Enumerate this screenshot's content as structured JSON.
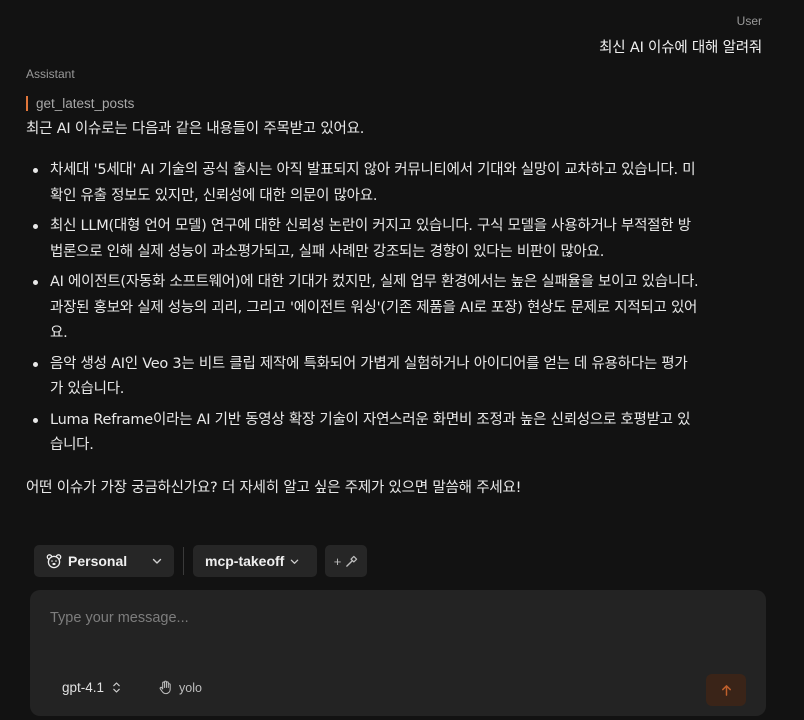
{
  "user": {
    "label": "User",
    "message": "최신 AI 이슈에 대해 알려줘"
  },
  "assistant": {
    "label": "Assistant",
    "tool_call": "get_latest_posts",
    "intro": "최근 AI 이슈로는 다음과 같은 내용들이 주목받고 있어요.",
    "bullets": [
      "차세대 '5세대' AI 기술의 공식 출시는 아직 발표되지 않아 커뮤니티에서 기대와 실망이 교차하고 있습니다. 미\n확인 유출 정보도 있지만, 신뢰성에 대한 의문이 많아요.",
      "최신 LLM(대형 언어 모델) 연구에 대한 신뢰성 논란이 커지고 있습니다. 구식 모델을 사용하거나 부적절한 방\n법론으로 인해 실제 성능이 과소평가되고, 실패 사례만 강조되는 경향이 있다는 비판이 많아요.",
      "AI 에이전트(자동화 소프트웨어)에 대한 기대가 컸지만, 실제 업무 환경에서는 높은 실패율을 보이고 있습니다.\n과장된 홍보와 실제 성능의 괴리, 그리고 '에이전트 워싱'(기존 제품을 AI로 포장) 현상도 문제로 지적되고 있어\n요.",
      "음악 생성 AI인 Veo 3는 비트 클립 제작에 특화되어 가볍게 실험하거나 아이디어를 얻는 데 유용하다는 평가\n가 있습니다.",
      "Luma Reframe이라는 AI 기반 동영상 확장 기술이 자연스러운 화면비 조정과 높은 신뢰성으로 호평받고 있\n습니다."
    ],
    "outro": "어떤 이슈가 가장 궁금하신가요? 더 자세히 알고 싶은 주제가 있으면 말씀해 주세요!"
  },
  "toolbar": {
    "profile": {
      "label": "Personal",
      "icon": "bear-icon"
    },
    "server": {
      "label": "mcp-takeoff"
    },
    "add_tool": {
      "label": "+",
      "icon": "hammer-icon"
    }
  },
  "composer": {
    "placeholder": "Type your message...",
    "model": "gpt-4.1",
    "mode": "yolo",
    "send_icon": "arrow-up-icon"
  },
  "colors": {
    "background": "#121212",
    "surface": "#232323",
    "pill": "#262626",
    "accent": "#e0763a",
    "send_bg": "#3a2418",
    "send_arrow": "#c0602c"
  }
}
